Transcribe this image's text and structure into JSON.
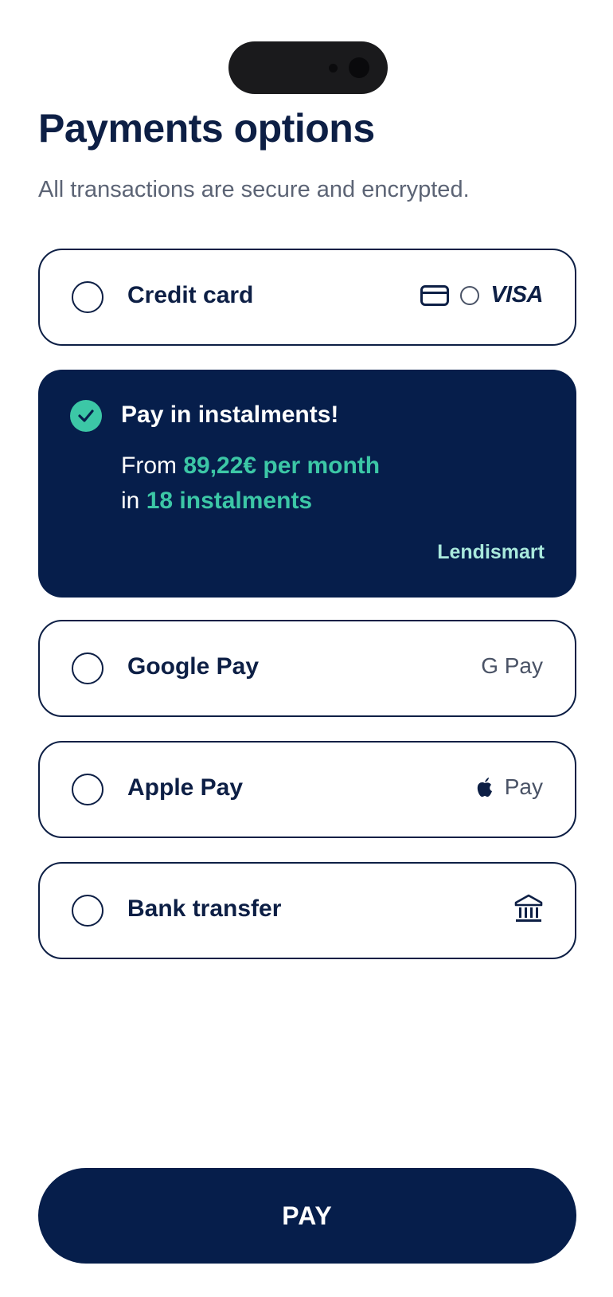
{
  "page": {
    "title": "Payments options",
    "subtitle": "All transactions are secure and encrypted."
  },
  "options": [
    {
      "label": "Credit card",
      "selected": false,
      "icons": [
        "card-icon",
        "circle-icon"
      ],
      "brand": "VISA"
    },
    {
      "label": "Google Pay",
      "selected": false,
      "brand": "G Pay"
    },
    {
      "label": "Apple Pay",
      "selected": false,
      "icons": [
        "apple-icon"
      ],
      "brand": "Pay"
    },
    {
      "label": "Bank transfer",
      "selected": false,
      "icons": [
        "bank-icon"
      ]
    }
  ],
  "instalments": {
    "title": "Pay in instalments!",
    "selected": true,
    "from_text": "From",
    "amount": "89,22€ per month",
    "in_text": "in",
    "count": "18 instalments",
    "provider": "Lendismart"
  },
  "pay_button": {
    "label": "PAY"
  },
  "colors": {
    "navy": "#061e4b",
    "accent": "#3cc7a6",
    "provider_text": "#a9e9dc"
  }
}
